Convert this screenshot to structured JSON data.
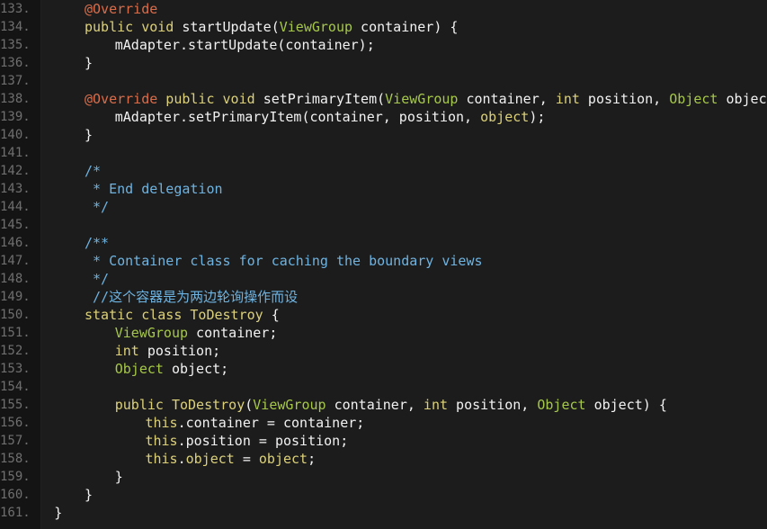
{
  "window": {
    "title": ""
  },
  "lines": [
    {
      "num": "133.",
      "indent": 4,
      "tokens": [
        {
          "t": "@Override",
          "c": "annotation"
        }
      ]
    },
    {
      "num": "134.",
      "indent": 4,
      "tokens": [
        {
          "t": "public void ",
          "c": "keyword"
        },
        {
          "t": "startUpdate(",
          "c": "default"
        },
        {
          "t": "ViewGroup",
          "c": "type"
        },
        {
          "t": " container) {",
          "c": "default"
        }
      ]
    },
    {
      "num": "135.",
      "indent": 8,
      "tokens": [
        {
          "t": "mAdapter.startUpdate(container);",
          "c": "default"
        }
      ]
    },
    {
      "num": "136.",
      "indent": 4,
      "tokens": [
        {
          "t": "}",
          "c": "default"
        }
      ]
    },
    {
      "num": "137.",
      "indent": 0,
      "tokens": []
    },
    {
      "num": "138.",
      "indent": 4,
      "tokens": [
        {
          "t": "@Override",
          "c": "annotation"
        },
        {
          "t": " public void ",
          "c": "keyword"
        },
        {
          "t": "setPrimaryItem(",
          "c": "default"
        },
        {
          "t": "ViewGroup",
          "c": "type"
        },
        {
          "t": " container, ",
          "c": "default"
        },
        {
          "t": "int",
          "c": "keyword"
        },
        {
          "t": " position, ",
          "c": "default"
        },
        {
          "t": "Object",
          "c": "type"
        },
        {
          "t": " object) {",
          "c": "default"
        }
      ]
    },
    {
      "num": "139.",
      "indent": 8,
      "tokens": [
        {
          "t": "mAdapter.setPrimaryItem(container, position, ",
          "c": "default"
        },
        {
          "t": "object",
          "c": "this"
        },
        {
          "t": ");",
          "c": "default"
        }
      ]
    },
    {
      "num": "140.",
      "indent": 4,
      "tokens": [
        {
          "t": "}",
          "c": "default"
        }
      ]
    },
    {
      "num": "141.",
      "indent": 0,
      "tokens": []
    },
    {
      "num": "142.",
      "indent": 4,
      "tokens": [
        {
          "t": "/*",
          "c": "comment"
        }
      ]
    },
    {
      "num": "143.",
      "indent": 4,
      "tokens": [
        {
          "t": " * End delegation",
          "c": "comment"
        }
      ]
    },
    {
      "num": "144.",
      "indent": 4,
      "tokens": [
        {
          "t": " */",
          "c": "comment"
        }
      ]
    },
    {
      "num": "145.",
      "indent": 0,
      "tokens": []
    },
    {
      "num": "146.",
      "indent": 4,
      "tokens": [
        {
          "t": "/**",
          "c": "comment"
        }
      ]
    },
    {
      "num": "147.",
      "indent": 4,
      "tokens": [
        {
          "t": " * Container class for caching the boundary views",
          "c": "comment"
        }
      ]
    },
    {
      "num": "148.",
      "indent": 4,
      "tokens": [
        {
          "t": " */",
          "c": "comment"
        }
      ]
    },
    {
      "num": "149.",
      "indent": 4,
      "tokens": [
        {
          "t": " //这个容器是为两边轮询操作而设",
          "c": "comment"
        }
      ]
    },
    {
      "num": "150.",
      "indent": 4,
      "tokens": [
        {
          "t": "static class ",
          "c": "keyword"
        },
        {
          "t": "ToDestroy",
          "c": "this"
        },
        {
          "t": " {",
          "c": "default"
        }
      ]
    },
    {
      "num": "151.",
      "indent": 8,
      "tokens": [
        {
          "t": "ViewGroup",
          "c": "type"
        },
        {
          "t": " container;",
          "c": "default"
        }
      ]
    },
    {
      "num": "152.",
      "indent": 8,
      "tokens": [
        {
          "t": "int",
          "c": "keyword"
        },
        {
          "t": " position;",
          "c": "default"
        }
      ]
    },
    {
      "num": "153.",
      "indent": 8,
      "tokens": [
        {
          "t": "Object",
          "c": "type"
        },
        {
          "t": " object;",
          "c": "default"
        }
      ]
    },
    {
      "num": "154.",
      "indent": 0,
      "tokens": []
    },
    {
      "num": "155.",
      "indent": 8,
      "tokens": [
        {
          "t": "public ",
          "c": "keyword"
        },
        {
          "t": "ToDestroy",
          "c": "this"
        },
        {
          "t": "(",
          "c": "default"
        },
        {
          "t": "ViewGroup",
          "c": "type"
        },
        {
          "t": " container, ",
          "c": "default"
        },
        {
          "t": "int",
          "c": "keyword"
        },
        {
          "t": " position, ",
          "c": "default"
        },
        {
          "t": "Object",
          "c": "type"
        },
        {
          "t": " object) {",
          "c": "default"
        }
      ]
    },
    {
      "num": "156.",
      "indent": 12,
      "tokens": [
        {
          "t": "this",
          "c": "this"
        },
        {
          "t": ".container = container;",
          "c": "default"
        }
      ]
    },
    {
      "num": "157.",
      "indent": 12,
      "tokens": [
        {
          "t": "this",
          "c": "this"
        },
        {
          "t": ".position = position;",
          "c": "default"
        }
      ]
    },
    {
      "num": "158.",
      "indent": 12,
      "tokens": [
        {
          "t": "this",
          "c": "this"
        },
        {
          "t": ".",
          "c": "default"
        },
        {
          "t": "object",
          "c": "this"
        },
        {
          "t": " = ",
          "c": "default"
        },
        {
          "t": "object",
          "c": "this"
        },
        {
          "t": ";",
          "c": "default"
        }
      ]
    },
    {
      "num": "159.",
      "indent": 8,
      "tokens": [
        {
          "t": "}",
          "c": "default"
        }
      ]
    },
    {
      "num": "160.",
      "indent": 4,
      "tokens": [
        {
          "t": "}",
          "c": "default"
        }
      ]
    },
    {
      "num": "161.",
      "indent": 0,
      "tokens": [
        {
          "t": "}",
          "c": "default"
        }
      ]
    }
  ],
  "colors": {
    "background": "#1c1c1c",
    "gutter": "#141414",
    "line_number": "#6f6f6f",
    "default": "#f2f2f2",
    "keyword": "#dcd17a",
    "annotation": "#d96d4a",
    "type": "#a6c84a",
    "comment": "#6fb3e0"
  }
}
